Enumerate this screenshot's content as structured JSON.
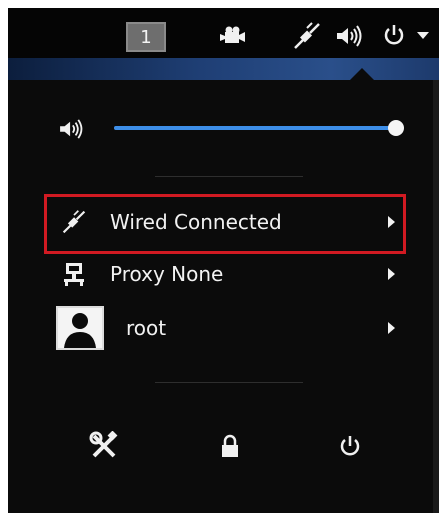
{
  "topbar": {
    "workspace_number": "1",
    "icons": [
      "camera-icon",
      "network-wired-icon",
      "volume-icon",
      "power-icon",
      "dropdown-arrow-icon"
    ]
  },
  "volume": {
    "level_percent": 100,
    "icon": "volume-icon"
  },
  "menu": {
    "items": [
      {
        "icon": "network-wired-icon",
        "label": "Wired Connected"
      },
      {
        "icon": "proxy-icon",
        "label": "Proxy None"
      },
      {
        "icon": "user-avatar",
        "label": "root"
      }
    ]
  },
  "bottom_actions": [
    "settings-icon",
    "lock-icon",
    "power-icon"
  ],
  "colors": {
    "panel_bg": "#0b0b0b",
    "accent_blue": "#3d8ee8",
    "highlight_red": "#d11a22",
    "text": "#f2f2f2"
  }
}
